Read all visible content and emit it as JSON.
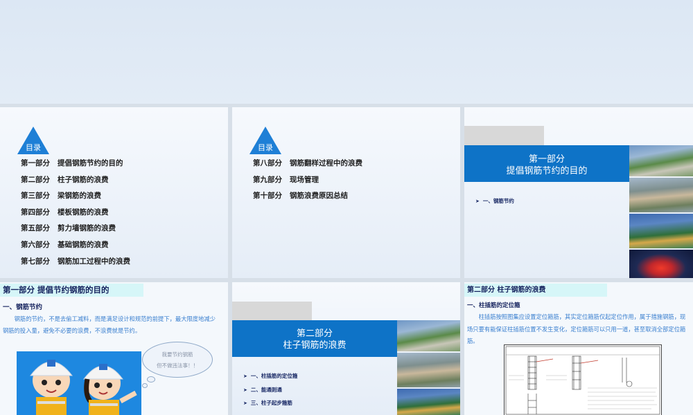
{
  "slides": {
    "toc1": {
      "badge": "目录",
      "items": [
        {
          "part": "第一部分",
          "title": "提倡钢筋节约的目的"
        },
        {
          "part": "第二部分",
          "title": "柱子钢筋的浪费"
        },
        {
          "part": "第三部分",
          "title": "梁钢筋的浪费"
        },
        {
          "part": "第四部分",
          "title": "楼板钢筋的浪费"
        },
        {
          "part": "第五部分",
          "title": "剪力墙钢筋的浪费"
        },
        {
          "part": "第六部分",
          "title": "基础钢筋的浪费"
        },
        {
          "part": "第七部分",
          "title": "钢筋加工过程中的浪费"
        }
      ]
    },
    "toc2": {
      "badge": "目录",
      "items": [
        {
          "part": "第八部分",
          "title": "钢筋翻样过程中的浪费"
        },
        {
          "part": "第九部分",
          "title": "现场管理"
        },
        {
          "part": "第十部分",
          "title": "钢筋浪费原因总结"
        }
      ]
    },
    "part1_cover": {
      "title_line1": "第一部分",
      "title_line2": "提倡钢筋节约的目的",
      "bullets": [
        "一、钢筋节约"
      ]
    },
    "part1_content": {
      "header": "第一部分  提倡节约钢筋的目的",
      "subheading": "一、钢筋节约",
      "paragraph": "钢筋的节约，不是去偷工减料，而是满足设计和规范的前提下，最大限度地减少钢筋的投入量，避免不必要的浪费，不浪费就是节约。",
      "bubble_line1": "我要节约钢筋",
      "bubble_line2": "但不做违法事！！"
    },
    "part2_cover": {
      "title_line1": "第二部分",
      "title_line2": "柱子钢筋的浪费",
      "bullets": [
        "一、柱插筋的定位箍",
        "二、能通则通",
        "三、柱子起步箍筋"
      ]
    },
    "part2_content": {
      "header": "第二部分  柱子钢筋的浪费",
      "subheading": "一、柱插筋的定位箍",
      "paragraph": "柱插筋按照图集应设置定位箍筋，其实定位箍筋仅起定位作用，属于措施钢筋，现场只要有能保证柱插筋位置不发生变化，定位箍筋可以只用一道，甚至取消全部定位箍筋。"
    }
  },
  "colors": {
    "banner_blue": "#0e73c7",
    "header_box": "#d6f6f8",
    "para_blue": "#3a7fcf",
    "badge_blue": "#1e7fd6"
  }
}
